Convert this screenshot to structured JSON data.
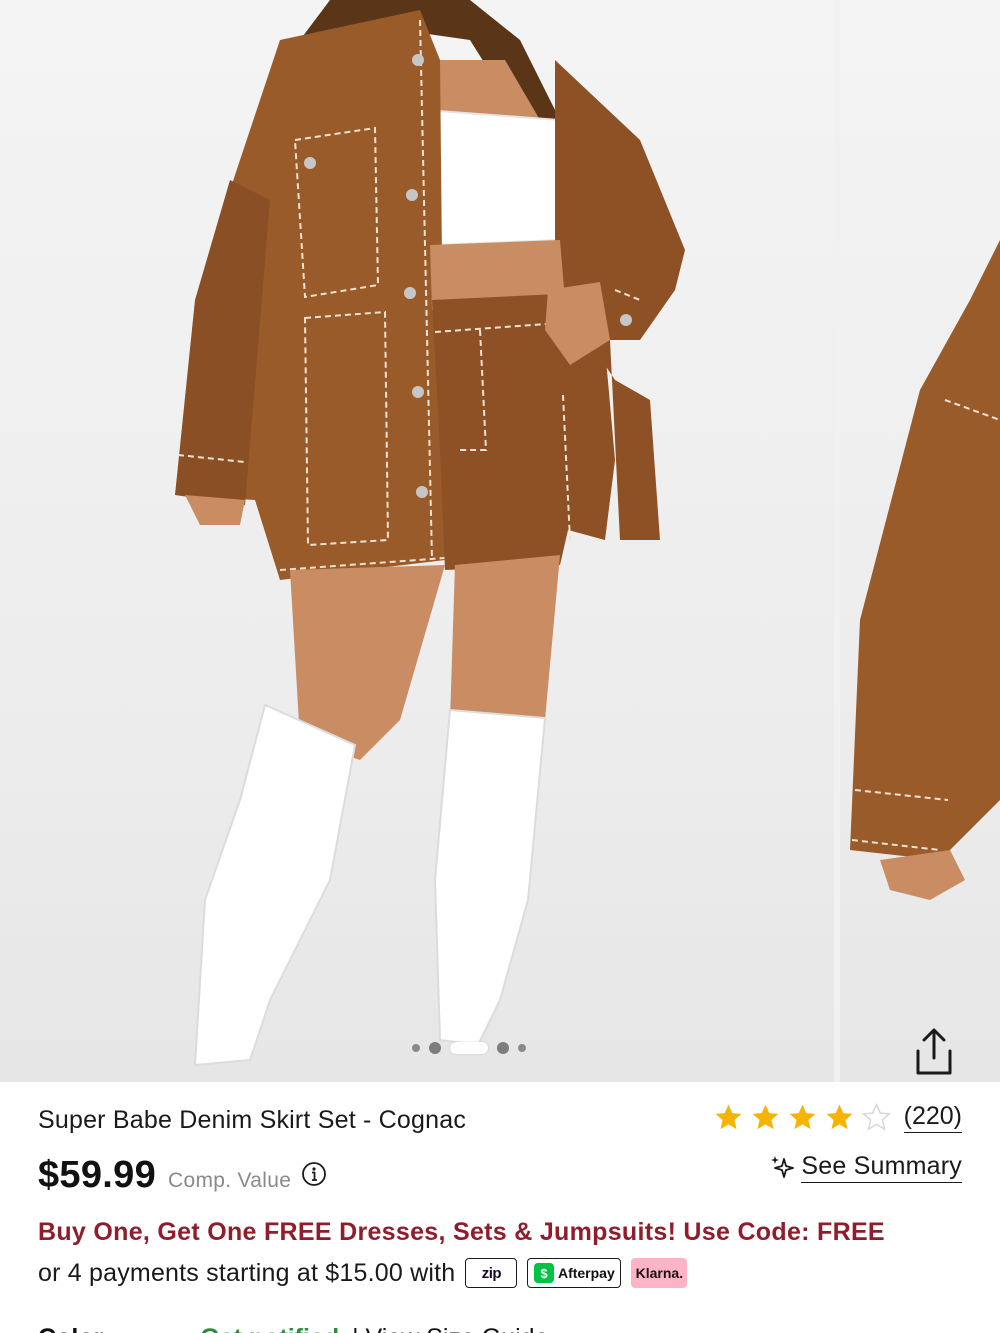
{
  "gallery": {
    "slide_count": 5,
    "active_index": 2
  },
  "product": {
    "title": "Super Babe Denim Skirt Set - Cognac",
    "rating": 4,
    "rating_max": 5,
    "review_count": "(220)",
    "price": "$59.99",
    "comp_value_label": "Comp. Value",
    "summary_label": "See Summary"
  },
  "promo": {
    "text": "Buy One, Get One FREE Dresses, Sets & Jumpsuits! Use Code: FREE"
  },
  "payments": {
    "text": "or 4 payments starting at $15.00 with",
    "providers": [
      "zip",
      "Afterpay",
      "Klarna."
    ]
  },
  "colors": {
    "promo": "#8f1d2c",
    "star": "#f5b400",
    "fabric": "#9a5b2a",
    "klarna": "#ffb3c7",
    "cashapp": "#00c244"
  },
  "icons": {
    "share": "share-icon",
    "info": "info-icon",
    "sparkle": "sparkle-icon",
    "star": "star-icon"
  }
}
